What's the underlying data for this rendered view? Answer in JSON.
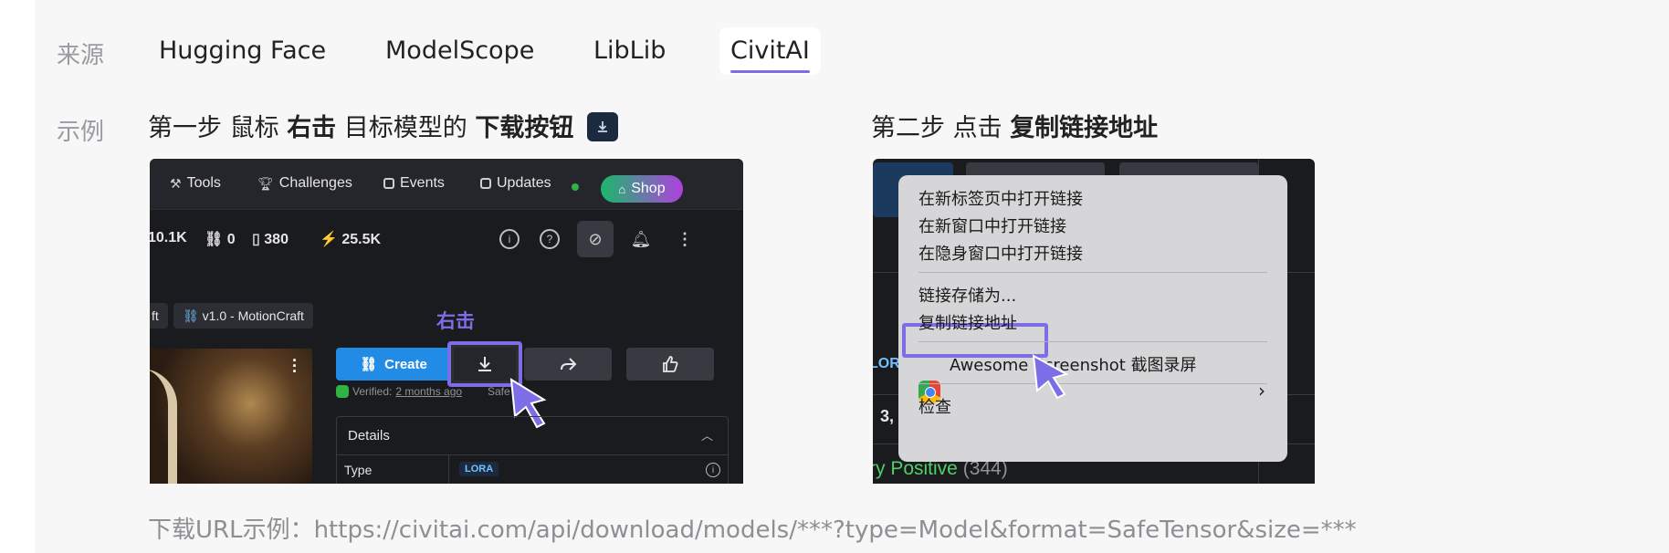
{
  "source": {
    "label": "来源",
    "tabs": [
      {
        "label": "Hugging Face",
        "active": false
      },
      {
        "label": "ModelScope",
        "active": false
      },
      {
        "label": "LibLib",
        "active": false
      },
      {
        "label": "CivitAI",
        "active": true
      }
    ]
  },
  "example": {
    "label": "示例",
    "step1": {
      "prefix": "第一步 鼠标",
      "action": "右击",
      "middle": "目标模型的",
      "target": "下载按钮"
    },
    "step2": {
      "prefix": "第二步 点击",
      "target": "复制链接地址"
    }
  },
  "shot1": {
    "nav": [
      "Tools",
      "Challenges",
      "Events",
      "Updates",
      "Shop"
    ],
    "stats": [
      "10.1K",
      "0",
      "380",
      "25.5K"
    ],
    "chips": [
      "ft",
      "v1.0 - MotionCraft"
    ],
    "right_click_label": "右击",
    "create_label": "Create",
    "verified_prefix": "Verified:",
    "verified_time": "2 months ago",
    "safe_label": "Safe",
    "details_label": "Details",
    "type_label": "Type",
    "type_value": "LORA"
  },
  "shot2": {
    "menu": {
      "open_new_tab": "在新标签页中打开链接",
      "open_new_window": "在新窗口中打开链接",
      "open_incognito": "在隐身窗口中打开链接",
      "save_link": "链接存储为...",
      "copy_link": "复制链接地址",
      "extension": "Awesome Screenshot 截图录屏",
      "inspect": "检查"
    },
    "bg_lora": "LORA",
    "bg_num": "3,",
    "bg_positive": "ry Positive",
    "bg_count": "(344)"
  },
  "url_example": "下载URL示例：https://civitai.com/api/download/models/***?type=Model&format=SafeTensor&size=***",
  "colors": {
    "accent": "#7b6ee6",
    "panel_bg": "#f7f7f8"
  }
}
